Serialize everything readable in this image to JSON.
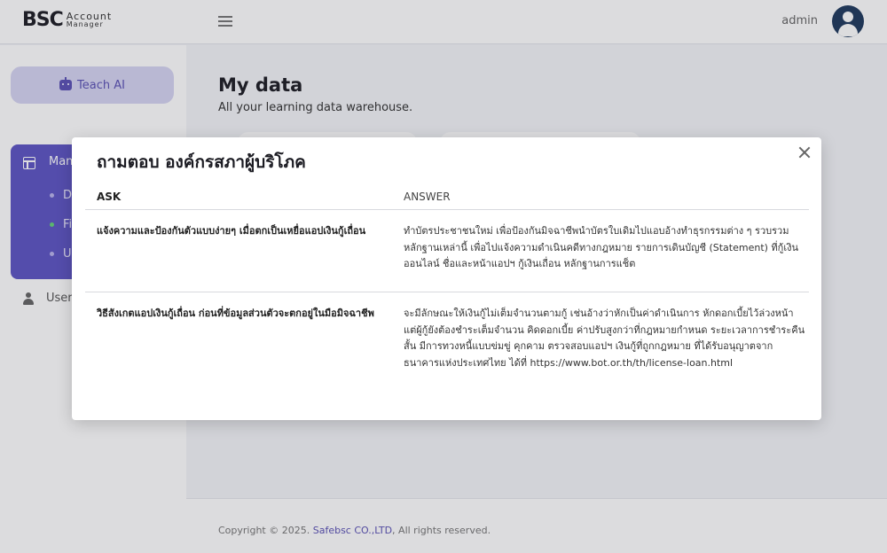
{
  "header": {
    "logo_mark": "BSC",
    "logo_line1": "Account",
    "logo_line2": "Manager",
    "user_name": "admin"
  },
  "sidebar": {
    "teach_ai_label": "Teach AI",
    "manage_label": "Man",
    "sub_items": [
      {
        "label": "D",
        "active": false
      },
      {
        "label": "Fi",
        "active": true
      },
      {
        "label": "U",
        "active": false
      }
    ],
    "user_label": "User"
  },
  "main": {
    "title": "My data",
    "subtitle": "All your learning data warehouse."
  },
  "footer": {
    "prefix": "Copyright © 2025. ",
    "company": "Safebsc CO.,LTD",
    "suffix": ", All rights reserved."
  },
  "modal": {
    "title": "ถามตอบ องค์กรสภาผู้บริโภค",
    "col_ask": "ASK",
    "col_answer": "ANSWER",
    "rows": [
      {
        "ask": "แจ้งความและป้องกันตัวแบบง่ายๆ เมื่อตกเป็นเหยื่อแอปเงินกู้เถื่อน",
        "answer": "ทำบัตรประชาชนใหม่ เพื่อป้องกันมิจฉาชีพนำบัตรใบเดิมไปแอบอ้างทำธุรกรรมต่าง ๆ รวบรวมหลักฐานเหล่านี้ เพื่อไปแจ้งความดำเนินคดีทางกฎหมาย รายการเดินบัญชี (Statement) ที่กู้เงินออนไลน์ ชื่อและหน้าแอปฯ กู้เงินเถื่อน หลักฐานการแช็ต"
      },
      {
        "ask": "วิธีสังเกตแอปเงินกู้เถื่อน ก่อนที่ข้อมูลส่วนตัวจะตกอยู่ในมือมิจฉาชีพ",
        "answer": "จะมีลักษณะให้เงินกู้ไม่เต็มจำนวนตามกู้ เช่นอ้างว่าหักเป็นค่าดำเนินการ หักดอกเบี้ยไว้ล่วงหน้า แต่ผู้กู้ยังต้องชำระเต็มจำนวน คิดดอกเบี้ย ค่าปรับสูงกว่าที่กฎหมายกำหนด ระยะเวลาการชำระคืนสั้น มีการทวงหนี้แบบข่มขู่ คุกคาม ตรวจสอบแอปฯ เงินกู้ที่ถูกกฎหมาย ที่ได้รับอนุญาตจาก ธนาคารแห่งประเทศไทย ได้ที่ https://www.bot.or.th/th/license-loan.html"
      }
    ]
  }
}
